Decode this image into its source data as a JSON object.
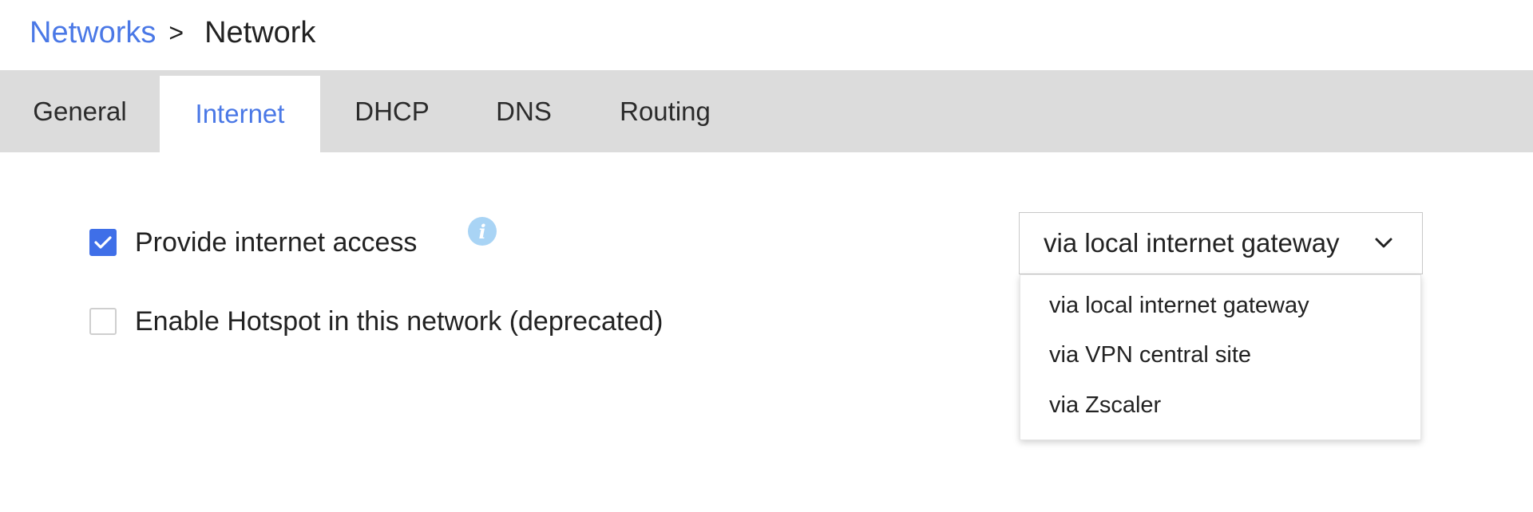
{
  "breadcrumb": {
    "parent": "Networks",
    "separator": ">",
    "current": "Network"
  },
  "tabs": [
    {
      "label": "General",
      "active": false
    },
    {
      "label": "Internet",
      "active": true
    },
    {
      "label": "DHCP",
      "active": false
    },
    {
      "label": "DNS",
      "active": false
    },
    {
      "label": "Routing",
      "active": false
    }
  ],
  "options": {
    "internet_access": {
      "label": "Provide internet access",
      "checked": true
    },
    "hotspot": {
      "label": "Enable Hotspot in this network (deprecated)",
      "checked": false
    }
  },
  "info_icon": {
    "glyph": "i",
    "icon": "info-icon"
  },
  "internet_select": {
    "value": "via local internet gateway",
    "options": [
      "via local internet gateway",
      "via VPN central site",
      "via Zscaler"
    ]
  },
  "colors": {
    "accent": "#4a78e6",
    "checkbox_checked": "#3f6fe8",
    "tabbar_bg": "#dcdcdc",
    "info_icon_bg": "#a9d4f5"
  }
}
